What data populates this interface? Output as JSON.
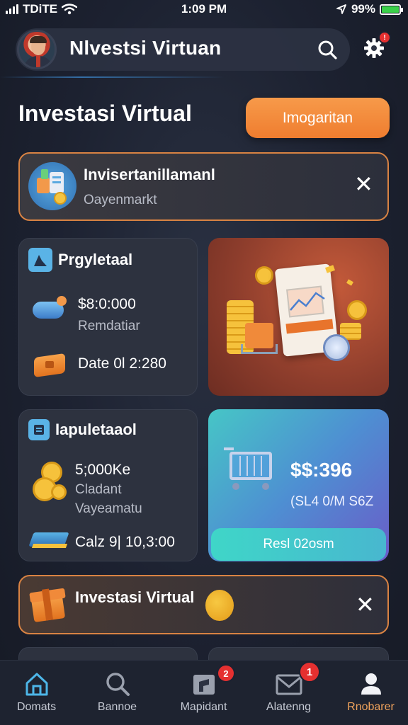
{
  "status_bar": {
    "carrier": "TDiTE",
    "time": "1:09 PM",
    "battery": "99%",
    "battery_level": 0.99
  },
  "header": {
    "title": "Nlvestsi Virtuan",
    "search_icon": "search-icon",
    "settings_icon": "gear-icon"
  },
  "page": {
    "title": "Investasi Virtual",
    "primary_button": "Imogaritan"
  },
  "banner_top": {
    "title": "Invisertanillamanl",
    "subtitle": "Oayenmarkt",
    "icon": "portfolio-chart-icon"
  },
  "card_1": {
    "title": "Prgyletaal",
    "amount": "$8:0:000",
    "amount_sub": "Remdatiar",
    "date": "Date 0l 2:280"
  },
  "card_2": {
    "title": "Iapuletaaol",
    "amount": "5;000Ke",
    "amount_sub1": "Cladant",
    "amount_sub2": "Vayeamatu",
    "date": "Calz 9| 10,3:00"
  },
  "promo": {
    "price": "$$:396",
    "sub": "(SL4 0/M S6Z",
    "button": "Resl 02osm"
  },
  "banner_bottom": {
    "title": "Investasi Virtual"
  },
  "bottom_nav": {
    "items": [
      {
        "label": "Domats",
        "icon": "home-icon",
        "active": false
      },
      {
        "label": "Bannoe",
        "icon": "search-icon",
        "active": false
      },
      {
        "label": "Mapidant",
        "icon": "portfolio-icon",
        "active": false,
        "badge": "2"
      },
      {
        "label": "Alatenng",
        "icon": "mail-icon",
        "active": false,
        "badge": "1"
      },
      {
        "label": "Rnobarer",
        "icon": "profile-icon",
        "active": true
      }
    ]
  },
  "colors": {
    "accent_orange": "#ef7d2f",
    "background": "#1c2130",
    "card": "#2d323f",
    "badge_red": "#e53030",
    "active_nav": "#f0a35c"
  }
}
